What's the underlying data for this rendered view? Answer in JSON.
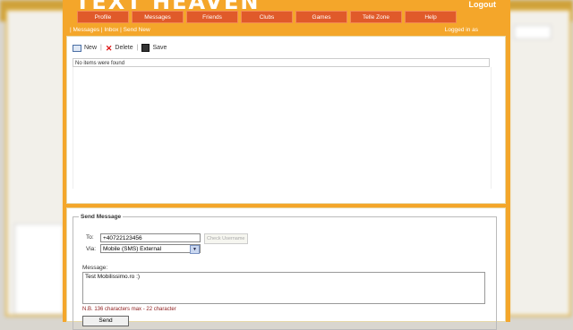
{
  "site": {
    "logo": "TEXT HEAVEN",
    "logout": "Logout"
  },
  "nav": [
    "Profile",
    "Messages",
    "Friends",
    "Clubs",
    "Games",
    "Telle Zone",
    "Help"
  ],
  "subbar": {
    "crumbs": [
      "Messages",
      "Inbox",
      "Send New"
    ],
    "login": "Logged in as"
  },
  "toolbar": {
    "new": "New",
    "delete": "Delete",
    "save": "Save"
  },
  "inbox": {
    "empty": "No items were found"
  },
  "send": {
    "legend": "Send Message",
    "to_label": "To:",
    "to_value": "+40722123456",
    "check_username": "Check Username",
    "via_label": "Via:",
    "via_value": "Mobile (SMS) External",
    "message_label": "Message:",
    "message_value": "Test Mobilissimo.ro :)",
    "note": "N.B. 136 characters max - 22 character",
    "send_button": "Send"
  },
  "colors": {
    "accent": "#f4a62a",
    "nav": "#e05a2a"
  }
}
